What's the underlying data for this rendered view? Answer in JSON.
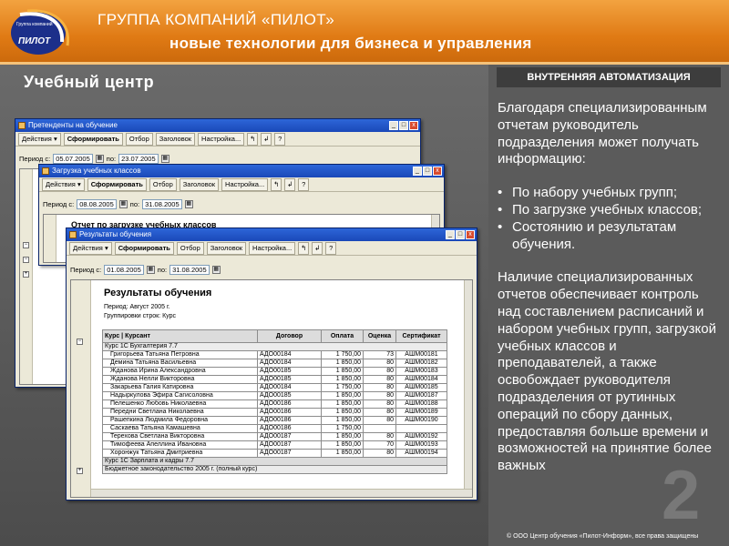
{
  "header": {
    "title": "ГРУППА КОМПАНИЙ «ПИЛОТ»",
    "subtitle": "новые технологии для бизнеса и управления",
    "logo_text": "ПИЛОТ",
    "logo_small": "Группа компаний"
  },
  "left_title": "Учебный центр",
  "right_panel": {
    "heading": "ВНУТРЕННЯЯ АВТОМАТИЗАЦИЯ",
    "intro": "Благодаря специализированным отчетам руководитель подразделения может получать информацию:",
    "bullets": [
      "По набору учебных групп;",
      "По загрузке учебных классов;",
      "Состоянию и результатам обучения."
    ],
    "bullet_glyph": "•",
    "para2": "Наличие специализированных отчетов обеспечивает контроль  над составлением расписаний и набором учебных групп, загрузкой учебных классов и преподавателей, а также освобождает руководителя подразделения от рутинных операций по сбору данных, предоставляя больше времени и возможностей на принятие более важных",
    "watermark": "2",
    "footer": "© ООО Центр обучения «Пилот-Информ», все права защищены"
  },
  "common": {
    "actions": "Действия ▾",
    "form": "Сформировать",
    "select": "Отбор",
    "heading": "Заголовок",
    "settings": "Настройка...",
    "help": "?",
    "from": "с:",
    "to": "по:",
    "win_min": "_",
    "win_max": "□",
    "win_close": "x",
    "plus": "+",
    "minus": "−"
  },
  "window1": {
    "title": "Претенденты на обучение",
    "period_label": "Период с:",
    "date_from": "05.07.2005",
    "date_to": "23.07.2005"
  },
  "window2": {
    "title": "Загрузка учебных классов",
    "period_label": "Период с:",
    "date_from": "08.08.2005",
    "date_to": "31.08.2005",
    "report_title": "Отчет по загрузке учебных классов"
  },
  "window3": {
    "title": "Результаты обучения",
    "period_label": "Период с:",
    "date_from": "01.08.2005",
    "date_to": "31.08.2005",
    "report_title": "Результаты обучения",
    "period_text": "Период:  Август 2005 г.",
    "grouping_text": "Группировки строк:  Курс",
    "columns": [
      "Курс | Курсант",
      "Договор",
      "Оплата",
      "Оценка",
      "Сертификат"
    ],
    "group1": "Курс 1С Бухгалтерия 7.7",
    "rows": [
      {
        "name": "Григорьева Татьяна Петровна",
        "contract": "АДО00184",
        "pay": "1 750,00",
        "grade": "73",
        "cert": "АШМ00181"
      },
      {
        "name": "Демина Татьяна Васильевна",
        "contract": "АДО00184",
        "pay": "1 850,00",
        "grade": "80",
        "cert": "АШМ00182"
      },
      {
        "name": "Жданова Ирина Александровна",
        "contract": "АДО00185",
        "pay": "1 850,00",
        "grade": "80",
        "cert": "АШМ00183"
      },
      {
        "name": "Жданова Нелли Викторовна",
        "contract": "АДО00185",
        "pay": "1 850,00",
        "grade": "80",
        "cert": "АШМ00184"
      },
      {
        "name": "Закарьева Галия Катировна",
        "contract": "АДО00184",
        "pay": "1 750,00",
        "grade": "80",
        "cert": "АШМ00185"
      },
      {
        "name": "Надыркулова Эфира Сагисоловна",
        "contract": "АДО00185",
        "pay": "1 850,00",
        "grade": "80",
        "cert": "АШМ00187"
      },
      {
        "name": "Пелешенко Любовь Николаевна",
        "contract": "АДО00186",
        "pay": "1 850,00",
        "grade": "80",
        "cert": "АШМ00188"
      },
      {
        "name": "Передни Светлана Николаевна",
        "contract": "АДО00186",
        "pay": "1 850,00",
        "grade": "80",
        "cert": "АШМ00189"
      },
      {
        "name": "Рашепкина Людмила Федоровна",
        "contract": "АДО00186",
        "pay": "1 850,00",
        "grade": "80",
        "cert": "АШМ00190"
      },
      {
        "name": "Саскаева Татьяна Камашевна",
        "contract": "АДО00186",
        "pay": "1 750,00",
        "grade": "",
        "cert": ""
      },
      {
        "name": "Терехова Светлана Викторовна",
        "contract": "АДО00187",
        "pay": "1 850,00",
        "grade": "80",
        "cert": "АШМ00192"
      },
      {
        "name": "Тимофеева Апеллина Ивановна",
        "contract": "АДО00187",
        "pay": "1 850,00",
        "grade": "70",
        "cert": "АШМ00193"
      },
      {
        "name": "Хоронжук Татьяна Дмитриевна",
        "contract": "АДО00187",
        "pay": "1 850,00",
        "grade": "80",
        "cert": "АШМ00194"
      }
    ],
    "group2": "Курс 1С Зарплата и кадры 7.7",
    "group3": "Бюджетное законодательство 2005 г. (полный курс)"
  },
  "colors": {
    "header_orange": "#e07a14",
    "titlebar_blue": "#1a48b8",
    "window_bg": "#ece9d8"
  }
}
